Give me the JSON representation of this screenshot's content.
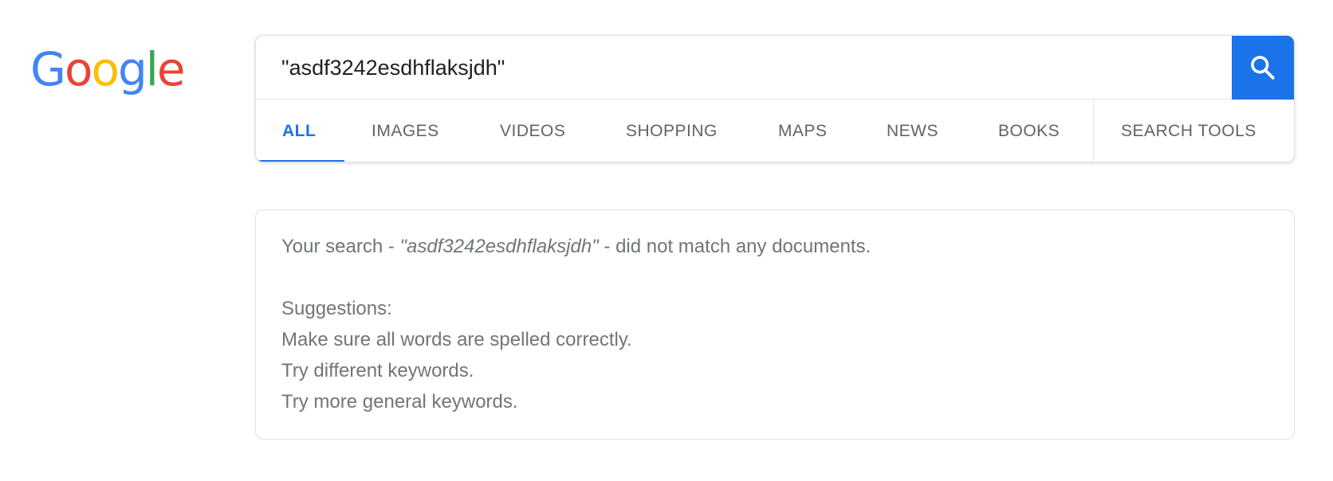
{
  "logo": {
    "letters": [
      {
        "char": "G",
        "color": "#4285F4"
      },
      {
        "char": "o",
        "color": "#EA4335"
      },
      {
        "char": "o",
        "color": "#FBBC05"
      },
      {
        "char": "g",
        "color": "#4285F4"
      },
      {
        "char": "l",
        "color": "#34A853"
      },
      {
        "char": "e",
        "color": "#EA4335"
      }
    ]
  },
  "search": {
    "query": "\"asdf3242esdhflaksjdh\"",
    "button_icon": "search-icon",
    "button_color": "#1a73e8"
  },
  "tabs": [
    {
      "label": "ALL",
      "active": true
    },
    {
      "label": "IMAGES",
      "active": false
    },
    {
      "label": "VIDEOS",
      "active": false
    },
    {
      "label": "SHOPPING",
      "active": false
    },
    {
      "label": "MAPS",
      "active": false
    },
    {
      "label": "NEWS",
      "active": false
    },
    {
      "label": "BOOKS",
      "active": false
    },
    {
      "label": "SEARCH TOOLS",
      "active": false
    }
  ],
  "results": {
    "no_match_prefix": "Your search - ",
    "no_match_query": "\"asdf3242esdhflaksjdh\"",
    "no_match_suffix": " - did not match any documents.",
    "suggestions_title": "Suggestions:",
    "suggestions": [
      "Make sure all words are spelled correctly.",
      "Try different keywords.",
      "Try more general keywords."
    ]
  },
  "colors": {
    "accent": "#1a73e8",
    "tab_text": "#5f6368",
    "body_text": "#70757a"
  }
}
